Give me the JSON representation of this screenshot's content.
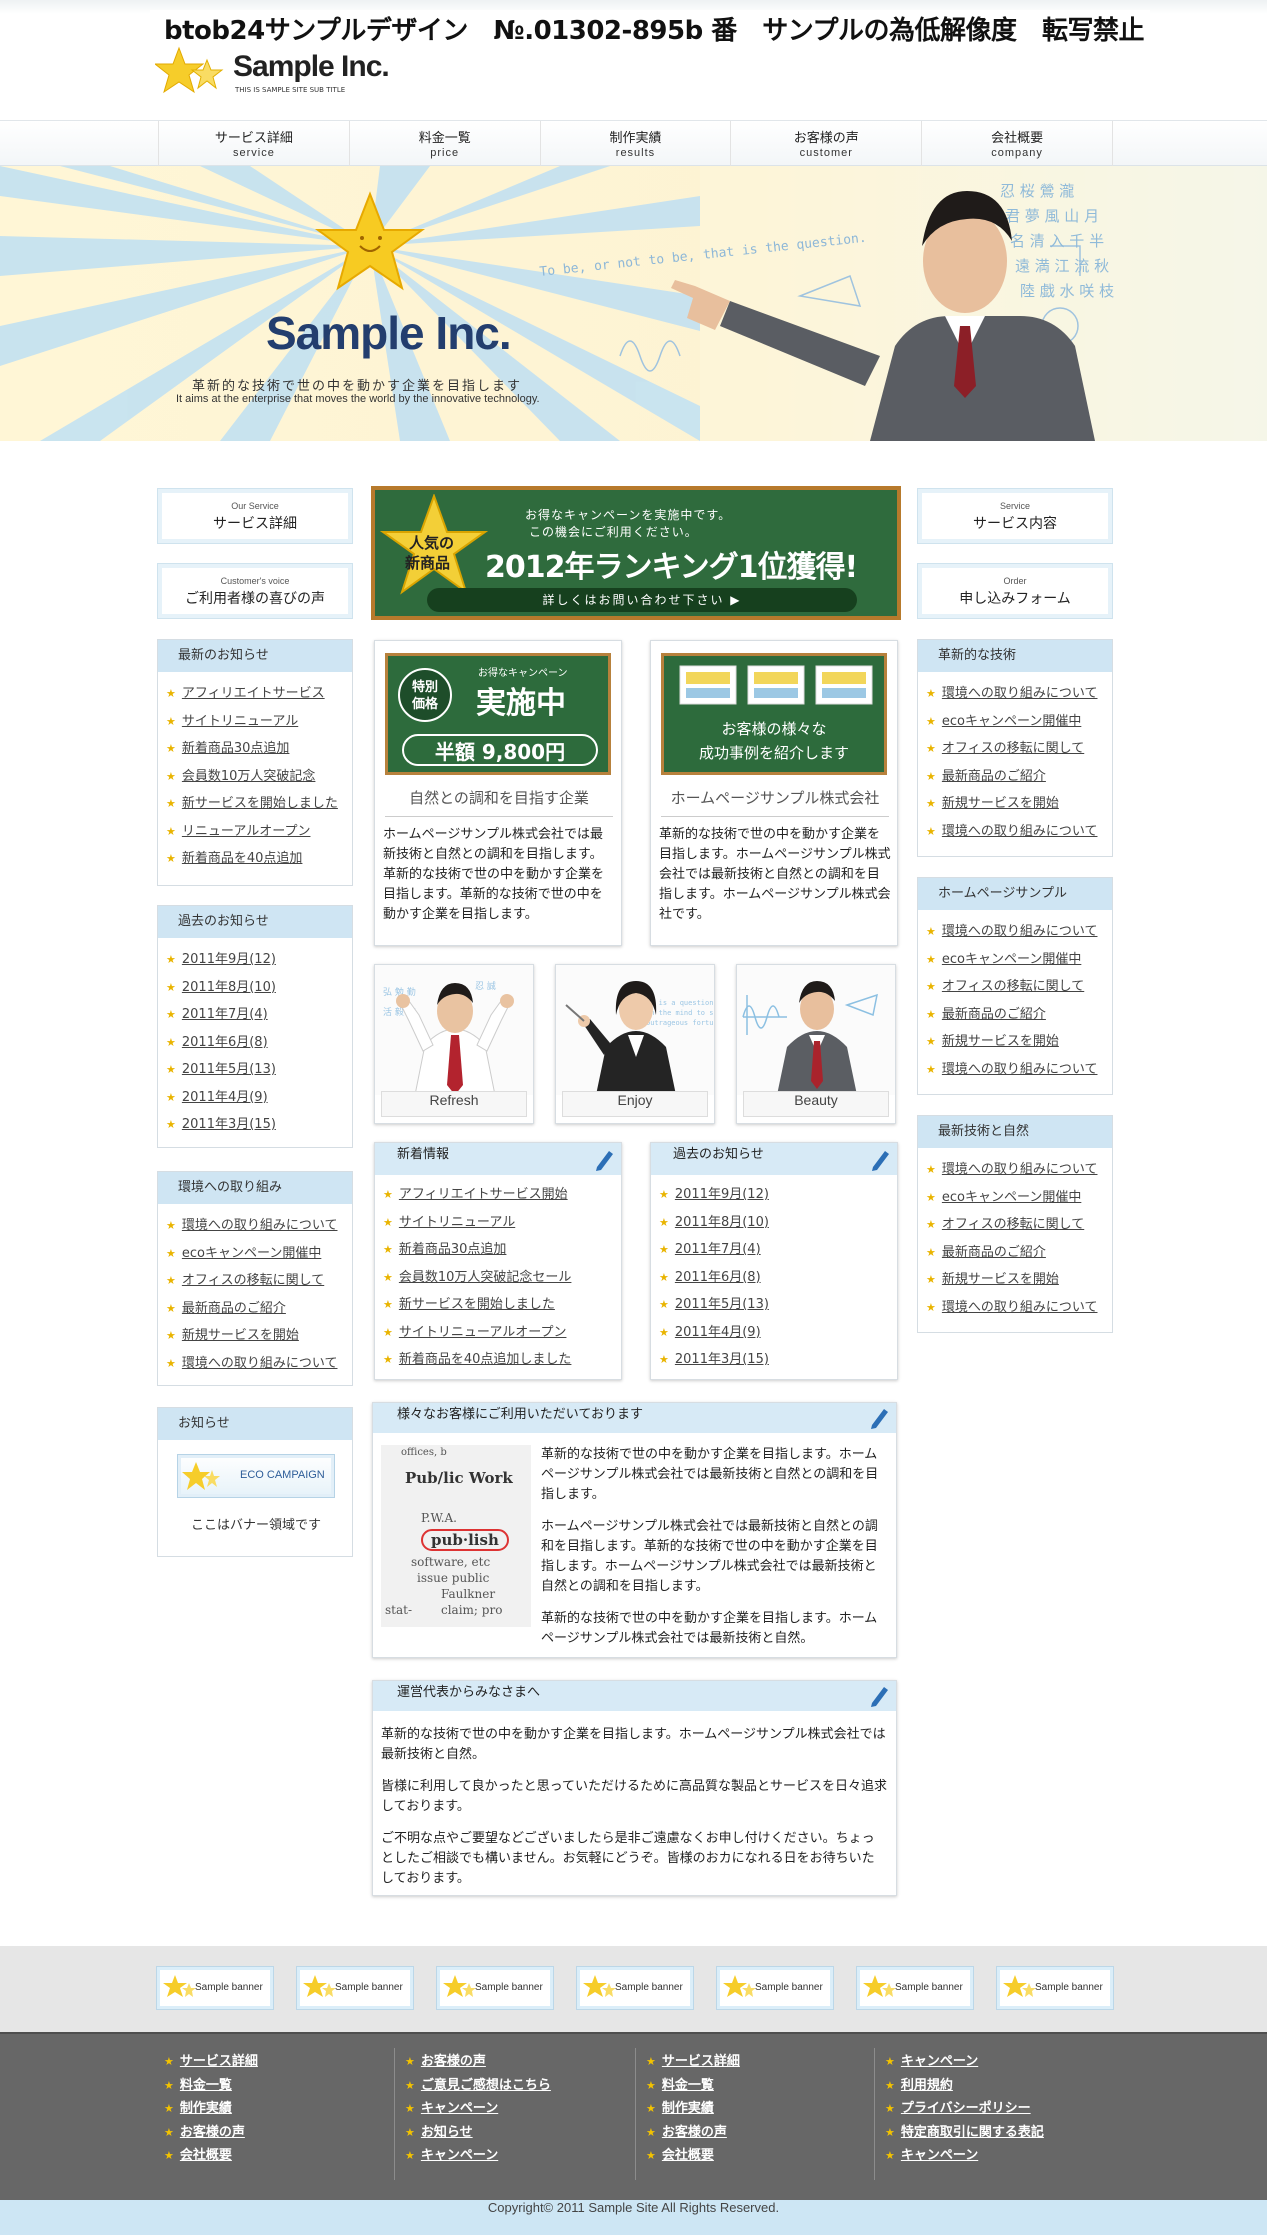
{
  "header": {
    "notice": "btob24サンプルデザイン　№.01302-895b 番　サンプルの為低解像度　転写禁止",
    "logo_text": "Sample Inc.",
    "logo_subtitle": "THIS IS SAMPLE SITE SUB TITLE"
  },
  "nav": [
    {
      "jp": "サービス詳細",
      "en": "service"
    },
    {
      "jp": "料金一覧",
      "en": "price"
    },
    {
      "jp": "制作実績",
      "en": "results"
    },
    {
      "jp": "お客様の声",
      "en": "customer"
    },
    {
      "jp": "会社概要",
      "en": "company"
    }
  ],
  "hero": {
    "title": "Sample Inc.",
    "tagline_jp": "革新的な技術で世の中を動かす企業を目指します",
    "tagline_en": "It aims at the enterprise that moves the world by the innovative technology.",
    "board_text": "To be, or not to be, that is the question."
  },
  "left": {
    "btn1": {
      "small": "Our Service",
      "main": "サービス詳細"
    },
    "btn2": {
      "small": "Customer's voice",
      "main": "ご利用者様の喜びの声"
    },
    "news": {
      "title": "最新のお知らせ",
      "items": [
        "アフィリエイトサービス",
        "サイトリニューアル",
        "新着商品30点追加",
        "会員数10万人突破記念",
        "新サービスを開始しました",
        "リニューアルオープン",
        "新着商品を40点追加"
      ]
    },
    "past": {
      "title": "過去のお知らせ",
      "items": [
        "2011年9月(12)",
        "2011年8月(10)",
        "2011年7月(4)",
        "2011年6月(8)",
        "2011年5月(13)",
        "2011年4月(9)",
        "2011年3月(15)"
      ]
    },
    "env": {
      "title": "環境への取り組み",
      "items": [
        "環境への取り組みについて",
        "ecoキャンペーン開催中",
        "オフィスの移転に関して",
        "最新商品のご紹介",
        "新規サービスを開始",
        "環境への取り組みについて"
      ]
    },
    "info": {
      "title": "お知らせ",
      "banner": "ECO CAMPAIGN",
      "caption": "ここはバナー領域です"
    }
  },
  "right": {
    "btn1": {
      "small": "Service",
      "main": "サービス内容"
    },
    "btn2": {
      "small": "Order",
      "main": "申し込みフォーム"
    },
    "box1": {
      "title": "革新的な技術",
      "items": [
        "環境への取り組みについて",
        "ecoキャンペーン開催中",
        "オフィスの移転に関して",
        "最新商品のご紹介",
        "新規サービスを開始",
        "環境への取り組みについて"
      ]
    },
    "box2": {
      "title": "ホームページサンプル",
      "items": [
        "環境への取り組みについて",
        "ecoキャンペーン開催中",
        "オフィスの移転に関して",
        "最新商品のご紹介",
        "新規サービスを開始",
        "環境への取り組みについて"
      ]
    },
    "box3": {
      "title": "最新技術と自然",
      "items": [
        "環境への取り組みについて",
        "ecoキャンペーン開催中",
        "オフィスの移転に関して",
        "最新商品のご紹介",
        "新規サービスを開始",
        "環境への取り組みについて"
      ]
    }
  },
  "center": {
    "promo": {
      "badge1": "人気の",
      "badge2": "新商品",
      "line1": "お得なキャンペーンを実施中です。",
      "line2": "この機会にご利用ください。",
      "headline": "2012年ランキング1位獲得!",
      "link": "詳しくはお問い合わせ下さい ▶"
    },
    "card1": {
      "tag": "特別価格",
      "small": "お得なキャンペーン",
      "big": "実施中",
      "price": "半額 9,800円",
      "title": "自然との調和を目指す企業",
      "text": "ホームページサンプル株式会社では最新技術と自然との調和を目指します。革新的な技術で世の中を動かす企業を目指します。革新的な技術で世の中を動かす企業を目指します。"
    },
    "card2": {
      "line1": "お客様の様々な",
      "line2": "成功事例を紹介します",
      "title": "ホームページサンプル株式会社",
      "text": "革新的な技術で世の中を動かす企業を目指します。ホームページサンプル株式会社では最新技術と自然との調和を目指します。ホームページサンプル株式会社です。"
    },
    "photos": [
      "Refresh",
      "Enjoy",
      "Beauty"
    ],
    "news": {
      "title": "新着情報",
      "items": [
        "アフィリエイトサービス開始",
        "サイトリニューアル",
        "新着商品30点追加",
        "会員数10万人突破記念セール",
        "新サービスを開始しました",
        "サイトリニューアルオープン",
        "新着商品を40点追加しました"
      ]
    },
    "past": {
      "title": "過去のお知らせ",
      "items": [
        "2011年9月(12)",
        "2011年8月(10)",
        "2011年7月(4)",
        "2011年6月(8)",
        "2011年5月(13)",
        "2011年4月(9)",
        "2011年3月(15)"
      ]
    },
    "customers": {
      "title": "様々なお客様にご利用いただいております",
      "p1": "革新的な技術で世の中を動かす企業を目指します。ホームページサンプル株式会社では最新技術と自然との調和を目指します。",
      "p2": "ホームページサンプル株式会社では最新技術と自然との調和を目指します。革新的な技術で世の中を動かす企業を目指します。ホームページサンプル株式会社では最新技術と自然との調和を目指します。",
      "p3": "革新的な技術で世の中を動かす企業を目指します。ホームページサンプル株式会社では最新技術と自然。",
      "paper": [
        "offices, b",
        "Pub/lic Work",
        "P.W.A.",
        "pub·lish",
        "software, etc",
        "issue public",
        "Faulkner",
        "claim; pro",
        "stat-"
      ]
    },
    "greeting": {
      "title": "運営代表からみなさまへ",
      "p1": "革新的な技術で世の中を動かす企業を目指します。ホームページサンプル株式会社では最新技術と自然。",
      "p2": "皆様に利用して良かったと思っていただけるために高品質な製品とサービスを日々追求しております。",
      "p3": "ご不明な点やご要望などございましたら是非ご遠慮なくお申し付けください。ちょっとしたご相談でも構いません。お気軽にどうぞ。皆様のおカになれる日をお待ちいたしております。"
    }
  },
  "banners": [
    "Sample banner",
    "Sample banner",
    "Sample banner",
    "Sample banner",
    "Sample banner",
    "Sample banner",
    "Sample banner"
  ],
  "footer": {
    "col1": [
      "サービス詳細",
      "料金一覧",
      "制作実績",
      "お客様の声",
      "会社概要"
    ],
    "col2": [
      "お客様の声",
      "ご意見ご感想はこちら",
      "キャンペーン",
      "お知らせ",
      "キャンペーン"
    ],
    "col3": [
      "サービス詳細",
      "料金一覧",
      "制作実績",
      "お客様の声",
      "会社概要"
    ],
    "col4": [
      "キャンペーン",
      "利用規約",
      "プライバシーポリシー",
      "特定商取引に関する表記",
      "キャンペーン"
    ],
    "copyright": "Copyright© 2011 Sample Site All Rights Reserved."
  },
  "colors": {
    "accent_blue": "#cfe5f3",
    "star_yellow": "#f5c400",
    "board_green": "#2f6b3d",
    "footer_gray": "#676767"
  }
}
